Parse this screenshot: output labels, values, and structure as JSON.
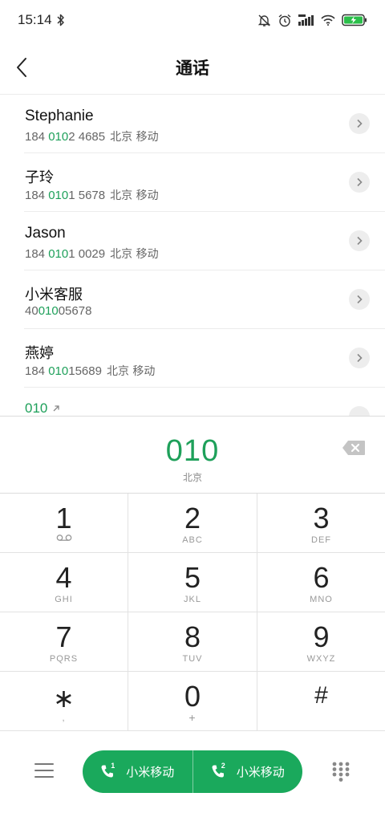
{
  "status_bar": {
    "time": "15:14",
    "icons": [
      "bluetooth-icon",
      "bell-muted-icon",
      "alarm-icon",
      "signal-icon",
      "wifi-icon",
      "battery-charging-icon"
    ]
  },
  "header": {
    "title": "通话",
    "back_icon": "chevron-left-icon"
  },
  "results": [
    {
      "name": "Stephanie",
      "number_prefix": "184 ",
      "number_match": "010",
      "number_suffix": "2 4685",
      "location": "北京 移动"
    },
    {
      "name": "子玲",
      "number_prefix": "184 ",
      "number_match": "010",
      "number_suffix": "1 5678",
      "location": "北京 移动"
    },
    {
      "name": "Jason",
      "number_prefix": "184 ",
      "number_match": "010",
      "number_suffix": "1 0029",
      "location": "北京 移动"
    },
    {
      "name": "小米客服",
      "number_prefix": "40",
      "number_match": "010",
      "number_suffix": "05678",
      "location": ""
    },
    {
      "name": "燕婷",
      "number_prefix": "184 ",
      "number_match": "010",
      "number_suffix": "15689",
      "location": "北京 移动"
    }
  ],
  "partial_result": {
    "number": "010",
    "icon": "outgoing-arrow-icon"
  },
  "dial": {
    "number": "010",
    "location": "北京",
    "backspace_icon": "backspace-icon"
  },
  "keypad": [
    {
      "digit": "1",
      "letters": "",
      "icon": "voicemail-icon"
    },
    {
      "digit": "2",
      "letters": "ABC"
    },
    {
      "digit": "3",
      "letters": "DEF"
    },
    {
      "digit": "4",
      "letters": "GHI"
    },
    {
      "digit": "5",
      "letters": "JKL"
    },
    {
      "digit": "6",
      "letters": "MNO"
    },
    {
      "digit": "7",
      "letters": "PQRS"
    },
    {
      "digit": "8",
      "letters": "TUV"
    },
    {
      "digit": "9",
      "letters": "WXYZ"
    },
    {
      "digit": "∗",
      "letters": ","
    },
    {
      "digit": "0",
      "letters": "+"
    },
    {
      "digit": "#",
      "letters": ""
    }
  ],
  "bottom_bar": {
    "menu_icon": "menu-icon",
    "sim1": {
      "sim": "1",
      "label": "小米移动"
    },
    "sim2": {
      "sim": "2",
      "label": "小米移动"
    },
    "keypad_icon": "dialpad-icon"
  },
  "colors": {
    "accent": "#1aa95c",
    "highlight": "#1ea05a",
    "divider": "#ececec"
  }
}
